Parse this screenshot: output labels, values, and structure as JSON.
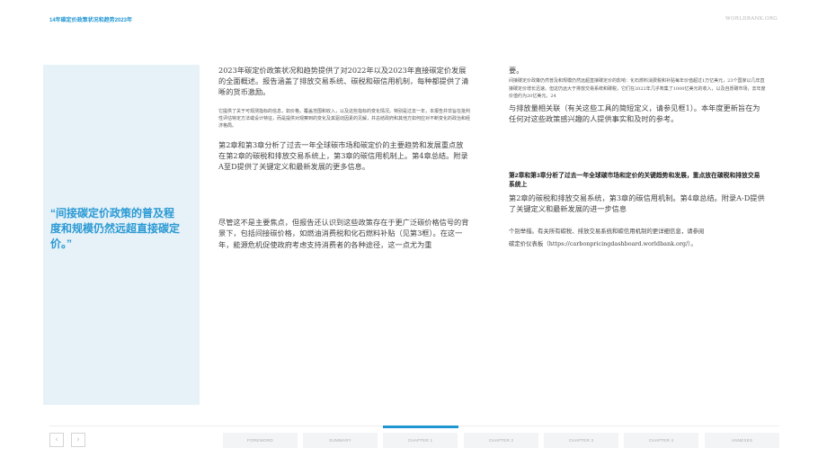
{
  "header": {
    "left_title": "14年碳定价政策状况和趋势2023年",
    "right_brand": "WORLDBANK.ORG"
  },
  "quote": {
    "text": "“间接碳定价政策的普及程度和规模仍然远超直接碳定价。”"
  },
  "column1": {
    "p1": "2023年碳定价政策状况和趋势提供了对2022年以及2023年直接碳定价发展的全面概述。报告涵盖了排放交易系统、碳税和碳信用机制，每种都提供了清晰的货币激励。",
    "p2": "它提供了关于可观测指标的信息，如价格，覆盖范围和收入，以及这些指标的变化情况。特别是过去一年，本报告并非旨在批判性评估特定方法或设计特征，而是提供对观察到的变化及其驱动因素的见解，并总结政府和其他方如何应对不断变化的政治和经济格局。",
    "p3": "第2章和第3章分析了过去一年全球碳市场和碳定价的主要趋势和发展重点放在第2章的碳税和排放交易系统上，第3章的碳信用机制上。第4章总结。附录A至D提供了关键定义和最新发展的更多信息。",
    "p4": "尽管这不是主要焦点，但报告还认识到这些政策存在于更广泛碳价格信号的背景下，包括间接碳价格，如燃油消费税和化石燃料补贴（见第3框）。在这一年，能源危机促使政府考虑支持消费者的各种途径，这一点尤为重"
  },
  "column2": {
    "p1": "要。",
    "p2": "间接碳定价政策仍然普及和规模仍然远超直接碳定价的影响：化石燃料消费税和补贴每年价值超过1万亿美元，23个国家以几年直接碳定价增长迅速。但这仍远大于排放交易系统和碳税，它们在2022年几乎筹集了1000亿美元的收入，以及自愿碳市场，去年度价值约为20亿美元。24",
    "p3": "与排放量相关联（有关这些工具的简短定义，请参见框1）。本年度更新旨在为任何对这些政策感兴趣的人提供事实和及时的参考。",
    "p4": "第2章和第3章分析了过去一年全球碳市场和定价的关键趋势和发展，重点放在碳税和排放交易系统上",
    "p5": "第2章的碳税和排放交易系统，第3章的碳信用机制。第4章总结。附录A-D提供了关键定义和最新发展的进一步信息",
    "p6": "个别举措。有关所有碳税、排放交易系统和碳信用机制的更详细信息，请参阅",
    "p7": "碳定价仪表板（https://carbonpricingdashboard.worldbank.org/）。"
  },
  "nav": {
    "prev_icon": "chevron-left-icon",
    "next_icon": "chevron-right-icon",
    "prev_glyph": "‹",
    "next_glyph": "›",
    "active_color": "#1e96d2",
    "active_index": 2,
    "tabs": [
      "FOREWORD",
      "SUMMARY",
      "CHAPTER 1",
      "CHAPTER 2",
      "CHAPTER 3",
      "CHAPTER 4",
      "ANNEXES"
    ]
  }
}
